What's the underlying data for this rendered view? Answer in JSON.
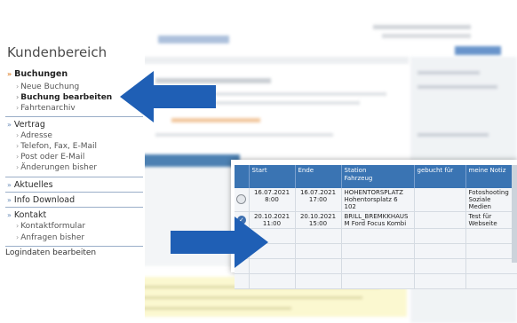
{
  "menu": {
    "title": "Kundenbereich",
    "sections": [
      {
        "label": "Buchungen",
        "mark": "»",
        "items": [
          "Neue Buchung",
          "Buchung bearbeiten",
          "Fahrtenarchiv"
        ]
      },
      {
        "label": "Vertrag",
        "mark": "»",
        "items": [
          "Adresse",
          "Telefon, Fax, E-Mail",
          "Post oder E-Mail",
          "Änderungen bisher"
        ]
      },
      {
        "label": "Aktuelles",
        "mark": "»",
        "items": []
      },
      {
        "label": "Info Download",
        "mark": "»",
        "items": []
      },
      {
        "label": "Kontakt",
        "mark": "»",
        "items": [
          "Kontaktformular",
          "Anfragen bisher"
        ]
      }
    ],
    "login": "Logindaten bearbeiten",
    "item_mark": "›"
  },
  "table": {
    "headers": [
      "",
      "Start",
      "Ende",
      "Station\nFahrzeug",
      "gebucht für",
      "meine Notiz"
    ],
    "rows": [
      {
        "icon": "radio-empty-icon",
        "start": "16.07.2021\n8:00",
        "end": "16.07.2021\n17:00",
        "station": "HOHENTORSPLATZ\nHohentorsplatz 6 102",
        "booked_for": "",
        "note": "Fotoshooting\nSoziale Medien"
      },
      {
        "icon": "checkmark-icon",
        "start": "20.10.2021\n11:00",
        "end": "20.10.2021\n15:00",
        "station": "BRILL_BREMKKHAUS\nM Ford Focus Kombi",
        "booked_for": "",
        "note": "Test für\nWebseite"
      }
    ],
    "check_glyph": "✓"
  },
  "colors": {
    "accent_blue": "#1f5fb5",
    "table_header": "#3a74b3",
    "logo_orange": "#f39a55"
  }
}
